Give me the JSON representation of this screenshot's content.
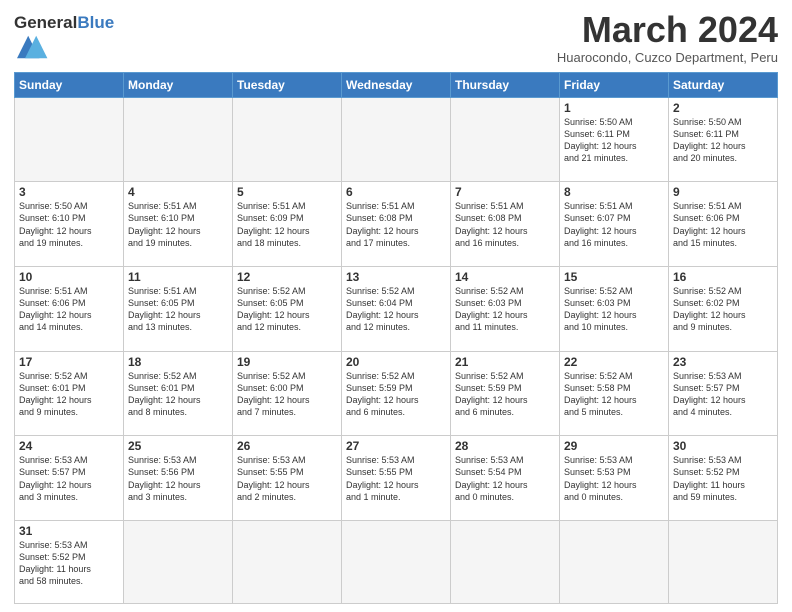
{
  "header": {
    "logo": {
      "general": "General",
      "blue": "Blue"
    },
    "title": "March 2024",
    "subtitle": "Huarocondo, Cuzco Department, Peru"
  },
  "weekdays": [
    "Sunday",
    "Monday",
    "Tuesday",
    "Wednesday",
    "Thursday",
    "Friday",
    "Saturday"
  ],
  "weeks": [
    [
      {
        "day": "",
        "info": "",
        "empty": true
      },
      {
        "day": "",
        "info": "",
        "empty": true
      },
      {
        "day": "",
        "info": "",
        "empty": true
      },
      {
        "day": "",
        "info": "",
        "empty": true
      },
      {
        "day": "",
        "info": "",
        "empty": true
      },
      {
        "day": "1",
        "info": "Sunrise: 5:50 AM\nSunset: 6:11 PM\nDaylight: 12 hours\nand 21 minutes."
      },
      {
        "day": "2",
        "info": "Sunrise: 5:50 AM\nSunset: 6:11 PM\nDaylight: 12 hours\nand 20 minutes."
      }
    ],
    [
      {
        "day": "3",
        "info": "Sunrise: 5:50 AM\nSunset: 6:10 PM\nDaylight: 12 hours\nand 19 minutes."
      },
      {
        "day": "4",
        "info": "Sunrise: 5:51 AM\nSunset: 6:10 PM\nDaylight: 12 hours\nand 19 minutes."
      },
      {
        "day": "5",
        "info": "Sunrise: 5:51 AM\nSunset: 6:09 PM\nDaylight: 12 hours\nand 18 minutes."
      },
      {
        "day": "6",
        "info": "Sunrise: 5:51 AM\nSunset: 6:08 PM\nDaylight: 12 hours\nand 17 minutes."
      },
      {
        "day": "7",
        "info": "Sunrise: 5:51 AM\nSunset: 6:08 PM\nDaylight: 12 hours\nand 16 minutes."
      },
      {
        "day": "8",
        "info": "Sunrise: 5:51 AM\nSunset: 6:07 PM\nDaylight: 12 hours\nand 16 minutes."
      },
      {
        "day": "9",
        "info": "Sunrise: 5:51 AM\nSunset: 6:06 PM\nDaylight: 12 hours\nand 15 minutes."
      }
    ],
    [
      {
        "day": "10",
        "info": "Sunrise: 5:51 AM\nSunset: 6:06 PM\nDaylight: 12 hours\nand 14 minutes."
      },
      {
        "day": "11",
        "info": "Sunrise: 5:51 AM\nSunset: 6:05 PM\nDaylight: 12 hours\nand 13 minutes."
      },
      {
        "day": "12",
        "info": "Sunrise: 5:52 AM\nSunset: 6:05 PM\nDaylight: 12 hours\nand 12 minutes."
      },
      {
        "day": "13",
        "info": "Sunrise: 5:52 AM\nSunset: 6:04 PM\nDaylight: 12 hours\nand 12 minutes."
      },
      {
        "day": "14",
        "info": "Sunrise: 5:52 AM\nSunset: 6:03 PM\nDaylight: 12 hours\nand 11 minutes."
      },
      {
        "day": "15",
        "info": "Sunrise: 5:52 AM\nSunset: 6:03 PM\nDaylight: 12 hours\nand 10 minutes."
      },
      {
        "day": "16",
        "info": "Sunrise: 5:52 AM\nSunset: 6:02 PM\nDaylight: 12 hours\nand 9 minutes."
      }
    ],
    [
      {
        "day": "17",
        "info": "Sunrise: 5:52 AM\nSunset: 6:01 PM\nDaylight: 12 hours\nand 9 minutes."
      },
      {
        "day": "18",
        "info": "Sunrise: 5:52 AM\nSunset: 6:01 PM\nDaylight: 12 hours\nand 8 minutes."
      },
      {
        "day": "19",
        "info": "Sunrise: 5:52 AM\nSunset: 6:00 PM\nDaylight: 12 hours\nand 7 minutes."
      },
      {
        "day": "20",
        "info": "Sunrise: 5:52 AM\nSunset: 5:59 PM\nDaylight: 12 hours\nand 6 minutes."
      },
      {
        "day": "21",
        "info": "Sunrise: 5:52 AM\nSunset: 5:59 PM\nDaylight: 12 hours\nand 6 minutes."
      },
      {
        "day": "22",
        "info": "Sunrise: 5:52 AM\nSunset: 5:58 PM\nDaylight: 12 hours\nand 5 minutes."
      },
      {
        "day": "23",
        "info": "Sunrise: 5:53 AM\nSunset: 5:57 PM\nDaylight: 12 hours\nand 4 minutes."
      }
    ],
    [
      {
        "day": "24",
        "info": "Sunrise: 5:53 AM\nSunset: 5:57 PM\nDaylight: 12 hours\nand 3 minutes."
      },
      {
        "day": "25",
        "info": "Sunrise: 5:53 AM\nSunset: 5:56 PM\nDaylight: 12 hours\nand 3 minutes."
      },
      {
        "day": "26",
        "info": "Sunrise: 5:53 AM\nSunset: 5:55 PM\nDaylight: 12 hours\nand 2 minutes."
      },
      {
        "day": "27",
        "info": "Sunrise: 5:53 AM\nSunset: 5:55 PM\nDaylight: 12 hours\nand 1 minute."
      },
      {
        "day": "28",
        "info": "Sunrise: 5:53 AM\nSunset: 5:54 PM\nDaylight: 12 hours\nand 0 minutes."
      },
      {
        "day": "29",
        "info": "Sunrise: 5:53 AM\nSunset: 5:53 PM\nDaylight: 12 hours\nand 0 minutes."
      },
      {
        "day": "30",
        "info": "Sunrise: 5:53 AM\nSunset: 5:52 PM\nDaylight: 11 hours\nand 59 minutes."
      }
    ],
    [
      {
        "day": "31",
        "info": "Sunrise: 5:53 AM\nSunset: 5:52 PM\nDaylight: 11 hours\nand 58 minutes.",
        "lastRow": true
      },
      {
        "day": "",
        "info": "",
        "empty": true,
        "lastRow": true
      },
      {
        "day": "",
        "info": "",
        "empty": true,
        "lastRow": true
      },
      {
        "day": "",
        "info": "",
        "empty": true,
        "lastRow": true
      },
      {
        "day": "",
        "info": "",
        "empty": true,
        "lastRow": true
      },
      {
        "day": "",
        "info": "",
        "empty": true,
        "lastRow": true
      },
      {
        "day": "",
        "info": "",
        "empty": true,
        "lastRow": true
      }
    ]
  ]
}
